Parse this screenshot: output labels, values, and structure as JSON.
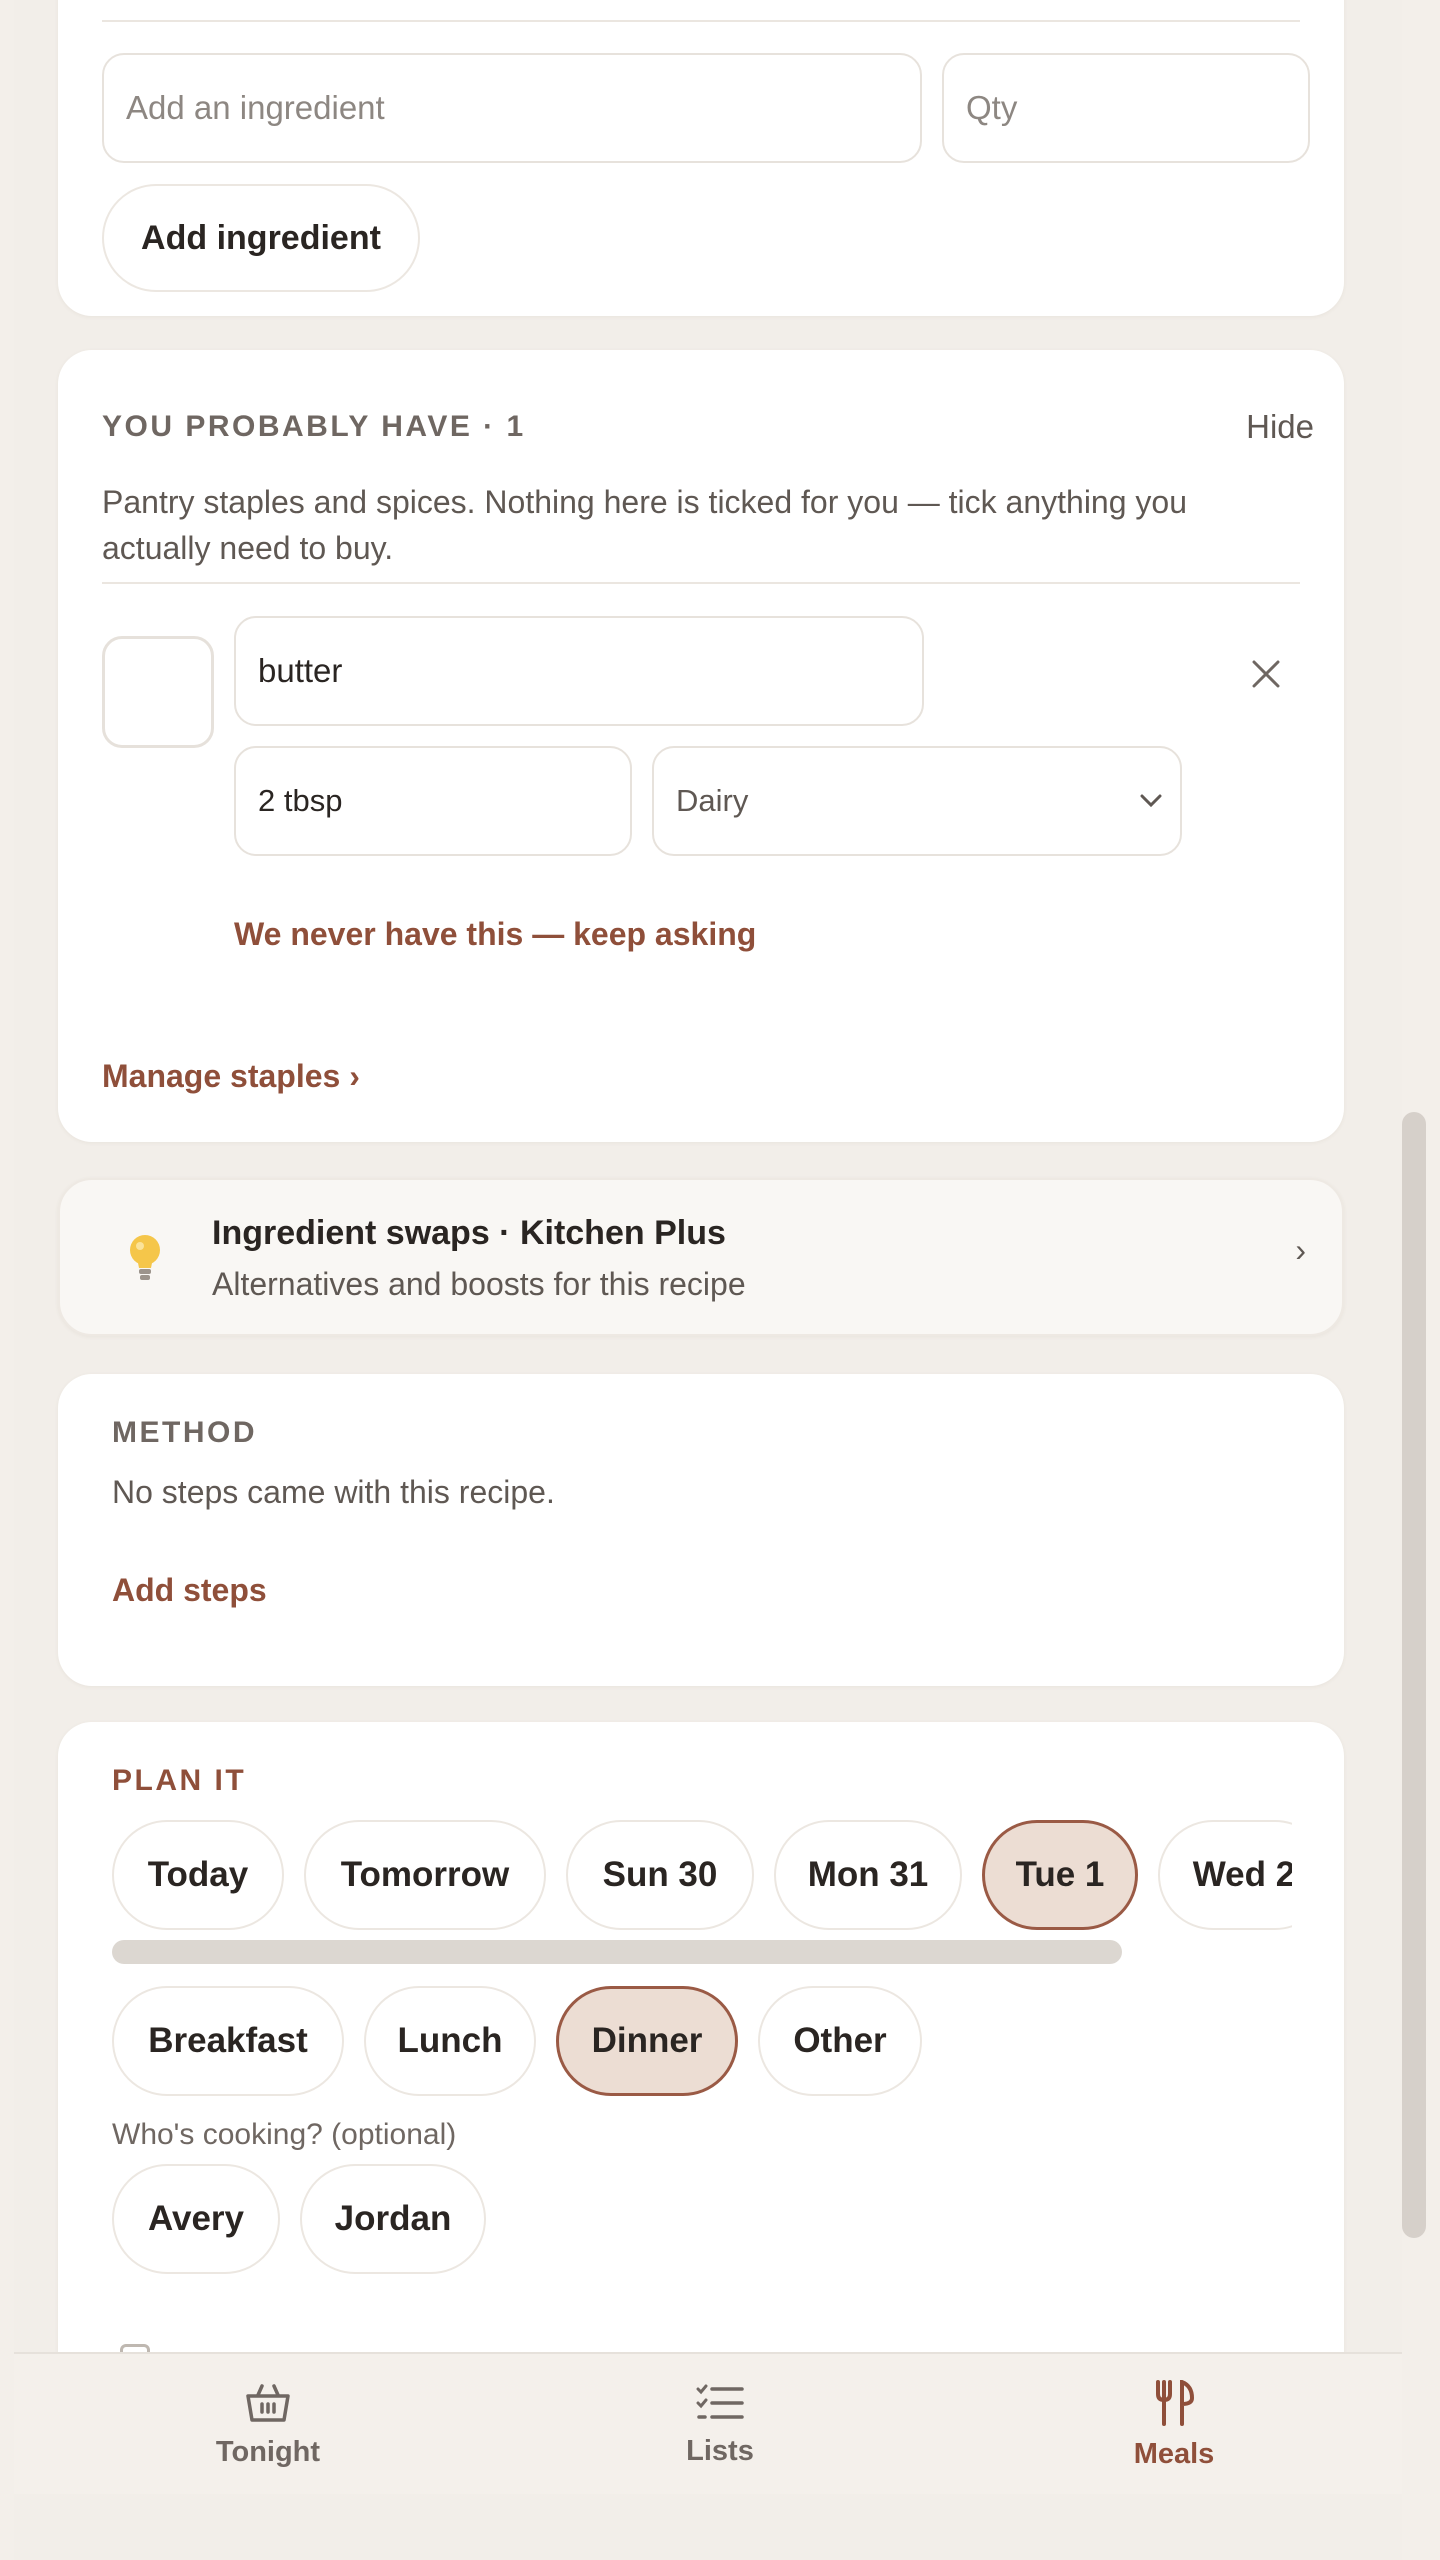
{
  "add_ingredient": {
    "name_placeholder": "Add an ingredient",
    "qty_placeholder": "Qty",
    "button_label": "Add ingredient"
  },
  "staples": {
    "eyebrow": "YOU PROBABLY HAVE · 1",
    "hide_label": "Hide",
    "description_line1": "Pantry staples and spices. Nothing here is ticked for you — tick anything you",
    "description_line2": "actually need to buy.",
    "item": {
      "name": "butter",
      "qty": "2 tbsp",
      "category": "Dairy",
      "never_have_label": "We never have this — keep asking"
    },
    "manage_label": "Manage staples ›"
  },
  "swaps": {
    "title": "Ingredient swaps · Kitchen Plus",
    "subtitle": "Alternatives and boosts for this recipe",
    "chevron": "›",
    "icon": "lightbulb-icon"
  },
  "method": {
    "eyebrow": "METHOD",
    "empty_text": "No steps came with this recipe.",
    "add_steps_label": "Add steps"
  },
  "plan": {
    "eyebrow": "PLAN IT",
    "days": [
      "Today",
      "Tomorrow",
      "Sun 30",
      "Mon 31",
      "Tue 1",
      "Wed 2"
    ],
    "selected_day": "Tue 1",
    "meals": [
      "Breakfast",
      "Lunch",
      "Dinner",
      "Other"
    ],
    "selected_meal": "Dinner",
    "cook_prompt": "Who's cooking? (optional)",
    "cooks": [
      "Avery",
      "Jordan"
    ]
  },
  "nav": {
    "tonight": "Tonight",
    "lists": "Lists",
    "meals": "Meals",
    "active": "Meals"
  },
  "colors": {
    "accent": "#8f4f3a",
    "selected_fill": "#ecddd3",
    "background": "#f3efea",
    "card": "#ffffff"
  }
}
